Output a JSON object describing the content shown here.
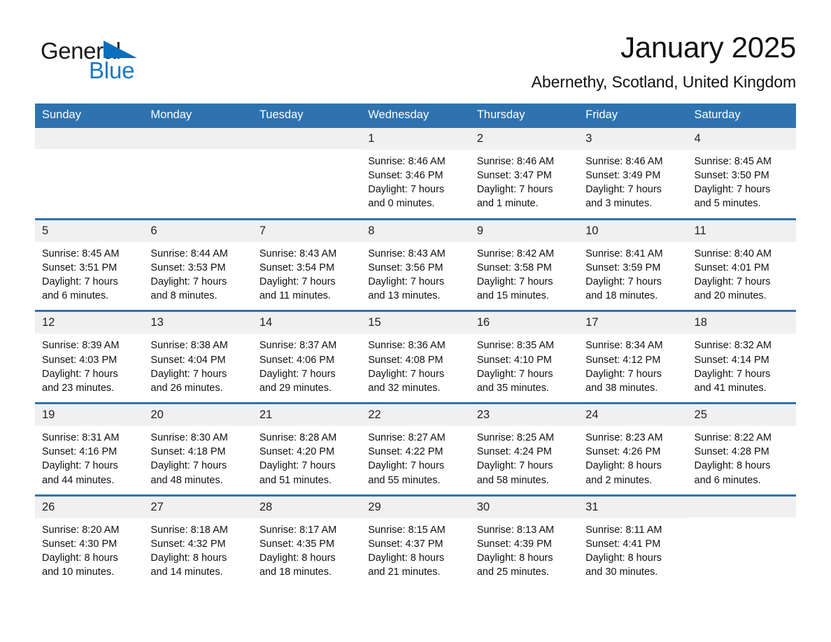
{
  "brand": {
    "name_top": "General",
    "name_bottom": "Blue",
    "accent_color": "#1878c4",
    "triangle_icon": "brand-triangle-icon"
  },
  "header": {
    "title": "January 2025",
    "subtitle": "Abernethy, Scotland, United Kingdom"
  },
  "calendar": {
    "header_bg": "#2e73b0",
    "day_band_bg": "#f0f0f0",
    "weekdays": [
      "Sunday",
      "Monday",
      "Tuesday",
      "Wednesday",
      "Thursday",
      "Friday",
      "Saturday"
    ],
    "weeks": [
      [
        {
          "day": "",
          "info": ""
        },
        {
          "day": "",
          "info": ""
        },
        {
          "day": "",
          "info": ""
        },
        {
          "day": "1",
          "info": "Sunrise: 8:46 AM\nSunset: 3:46 PM\nDaylight: 7 hours\nand 0 minutes."
        },
        {
          "day": "2",
          "info": "Sunrise: 8:46 AM\nSunset: 3:47 PM\nDaylight: 7 hours\nand 1 minute."
        },
        {
          "day": "3",
          "info": "Sunrise: 8:46 AM\nSunset: 3:49 PM\nDaylight: 7 hours\nand 3 minutes."
        },
        {
          "day": "4",
          "info": "Sunrise: 8:45 AM\nSunset: 3:50 PM\nDaylight: 7 hours\nand 5 minutes."
        }
      ],
      [
        {
          "day": "5",
          "info": "Sunrise: 8:45 AM\nSunset: 3:51 PM\nDaylight: 7 hours\nand 6 minutes."
        },
        {
          "day": "6",
          "info": "Sunrise: 8:44 AM\nSunset: 3:53 PM\nDaylight: 7 hours\nand 8 minutes."
        },
        {
          "day": "7",
          "info": "Sunrise: 8:43 AM\nSunset: 3:54 PM\nDaylight: 7 hours\nand 11 minutes."
        },
        {
          "day": "8",
          "info": "Sunrise: 8:43 AM\nSunset: 3:56 PM\nDaylight: 7 hours\nand 13 minutes."
        },
        {
          "day": "9",
          "info": "Sunrise: 8:42 AM\nSunset: 3:58 PM\nDaylight: 7 hours\nand 15 minutes."
        },
        {
          "day": "10",
          "info": "Sunrise: 8:41 AM\nSunset: 3:59 PM\nDaylight: 7 hours\nand 18 minutes."
        },
        {
          "day": "11",
          "info": "Sunrise: 8:40 AM\nSunset: 4:01 PM\nDaylight: 7 hours\nand 20 minutes."
        }
      ],
      [
        {
          "day": "12",
          "info": "Sunrise: 8:39 AM\nSunset: 4:03 PM\nDaylight: 7 hours\nand 23 minutes."
        },
        {
          "day": "13",
          "info": "Sunrise: 8:38 AM\nSunset: 4:04 PM\nDaylight: 7 hours\nand 26 minutes."
        },
        {
          "day": "14",
          "info": "Sunrise: 8:37 AM\nSunset: 4:06 PM\nDaylight: 7 hours\nand 29 minutes."
        },
        {
          "day": "15",
          "info": "Sunrise: 8:36 AM\nSunset: 4:08 PM\nDaylight: 7 hours\nand 32 minutes."
        },
        {
          "day": "16",
          "info": "Sunrise: 8:35 AM\nSunset: 4:10 PM\nDaylight: 7 hours\nand 35 minutes."
        },
        {
          "day": "17",
          "info": "Sunrise: 8:34 AM\nSunset: 4:12 PM\nDaylight: 7 hours\nand 38 minutes."
        },
        {
          "day": "18",
          "info": "Sunrise: 8:32 AM\nSunset: 4:14 PM\nDaylight: 7 hours\nand 41 minutes."
        }
      ],
      [
        {
          "day": "19",
          "info": "Sunrise: 8:31 AM\nSunset: 4:16 PM\nDaylight: 7 hours\nand 44 minutes."
        },
        {
          "day": "20",
          "info": "Sunrise: 8:30 AM\nSunset: 4:18 PM\nDaylight: 7 hours\nand 48 minutes."
        },
        {
          "day": "21",
          "info": "Sunrise: 8:28 AM\nSunset: 4:20 PM\nDaylight: 7 hours\nand 51 minutes."
        },
        {
          "day": "22",
          "info": "Sunrise: 8:27 AM\nSunset: 4:22 PM\nDaylight: 7 hours\nand 55 minutes."
        },
        {
          "day": "23",
          "info": "Sunrise: 8:25 AM\nSunset: 4:24 PM\nDaylight: 7 hours\nand 58 minutes."
        },
        {
          "day": "24",
          "info": "Sunrise: 8:23 AM\nSunset: 4:26 PM\nDaylight: 8 hours\nand 2 minutes."
        },
        {
          "day": "25",
          "info": "Sunrise: 8:22 AM\nSunset: 4:28 PM\nDaylight: 8 hours\nand 6 minutes."
        }
      ],
      [
        {
          "day": "26",
          "info": "Sunrise: 8:20 AM\nSunset: 4:30 PM\nDaylight: 8 hours\nand 10 minutes."
        },
        {
          "day": "27",
          "info": "Sunrise: 8:18 AM\nSunset: 4:32 PM\nDaylight: 8 hours\nand 14 minutes."
        },
        {
          "day": "28",
          "info": "Sunrise: 8:17 AM\nSunset: 4:35 PM\nDaylight: 8 hours\nand 18 minutes."
        },
        {
          "day": "29",
          "info": "Sunrise: 8:15 AM\nSunset: 4:37 PM\nDaylight: 8 hours\nand 21 minutes."
        },
        {
          "day": "30",
          "info": "Sunrise: 8:13 AM\nSunset: 4:39 PM\nDaylight: 8 hours\nand 25 minutes."
        },
        {
          "day": "31",
          "info": "Sunrise: 8:11 AM\nSunset: 4:41 PM\nDaylight: 8 hours\nand 30 minutes."
        },
        {
          "day": "",
          "info": ""
        }
      ]
    ]
  }
}
